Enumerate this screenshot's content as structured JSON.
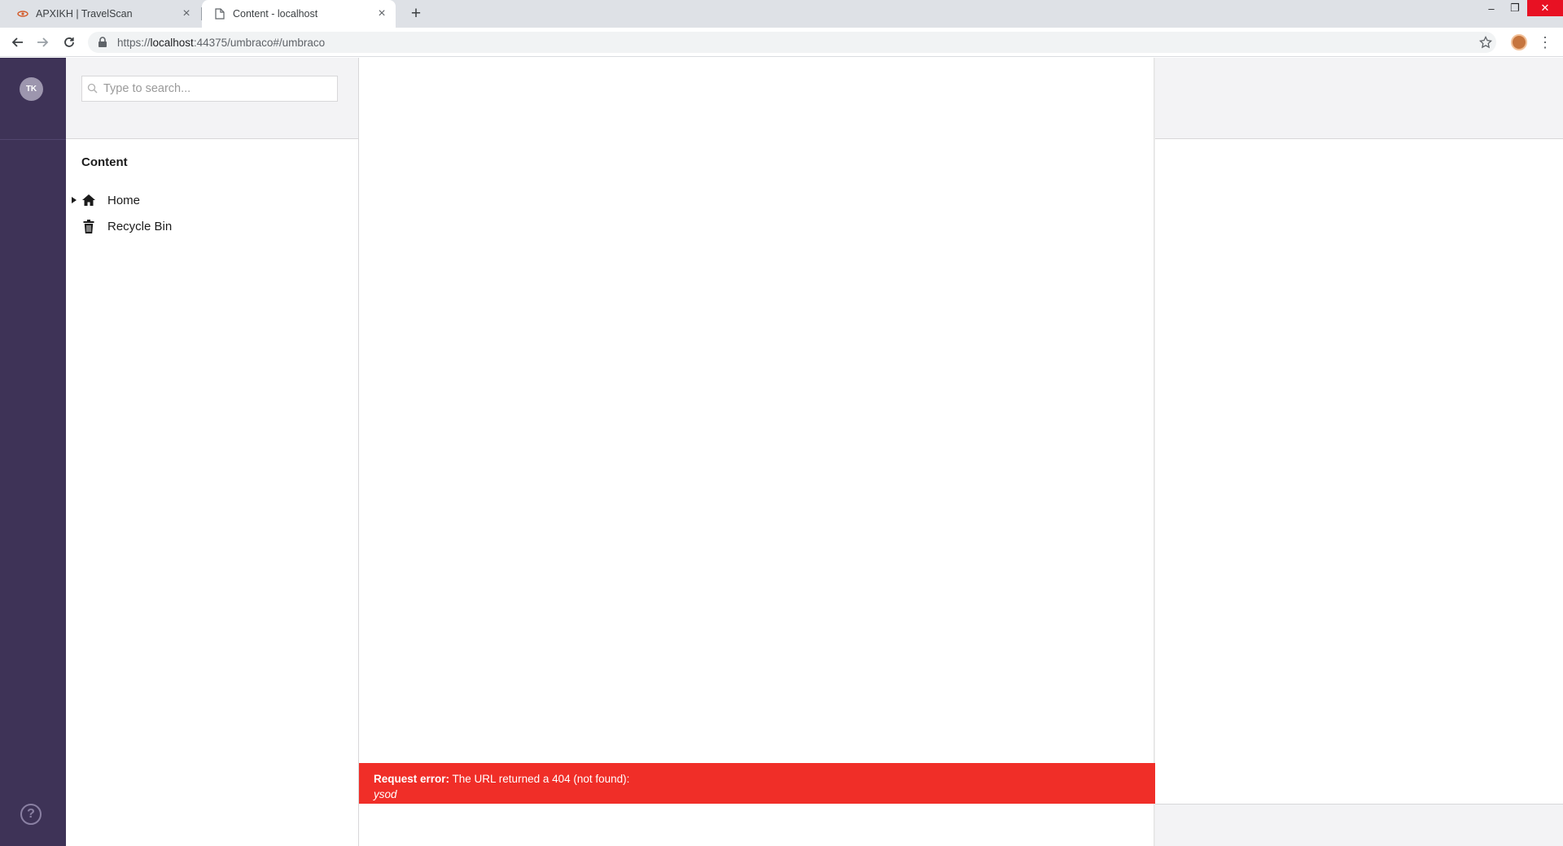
{
  "browser": {
    "tabs": [
      {
        "title": "APXIKH | TravelScan",
        "active": false,
        "favicon": "travelscan-favicon"
      },
      {
        "title": "Content - localhost",
        "active": true,
        "favicon": "document-icon"
      }
    ],
    "close_glyph": "×",
    "new_tab_glyph": "+",
    "window_controls": {
      "minimize": "–",
      "maximize": "❐",
      "close": "✕"
    },
    "url": {
      "scheme": "https://",
      "host": "localhost",
      "rest": ":44375/umbraco#/umbraco"
    },
    "menu_glyph": "⋮",
    "colors": {
      "tabstrip": "#dee1e6",
      "close_window": "#e81123"
    }
  },
  "umbraco": {
    "user_initials": "TK",
    "help_glyph": "?",
    "search": {
      "placeholder": "Type to search..."
    },
    "tree": {
      "title": "Content",
      "nodes": [
        {
          "label": "Home",
          "icon": "home-icon",
          "expandable": true
        },
        {
          "label": "Recycle Bin",
          "icon": "trash-icon",
          "expandable": false
        }
      ]
    },
    "error": {
      "label": "Request error:",
      "message": " The URL returned a 404 (not found):",
      "detail": "ysod"
    },
    "colors": {
      "sections_bg": "#3e3357",
      "error_bg": "#f02e28"
    }
  }
}
